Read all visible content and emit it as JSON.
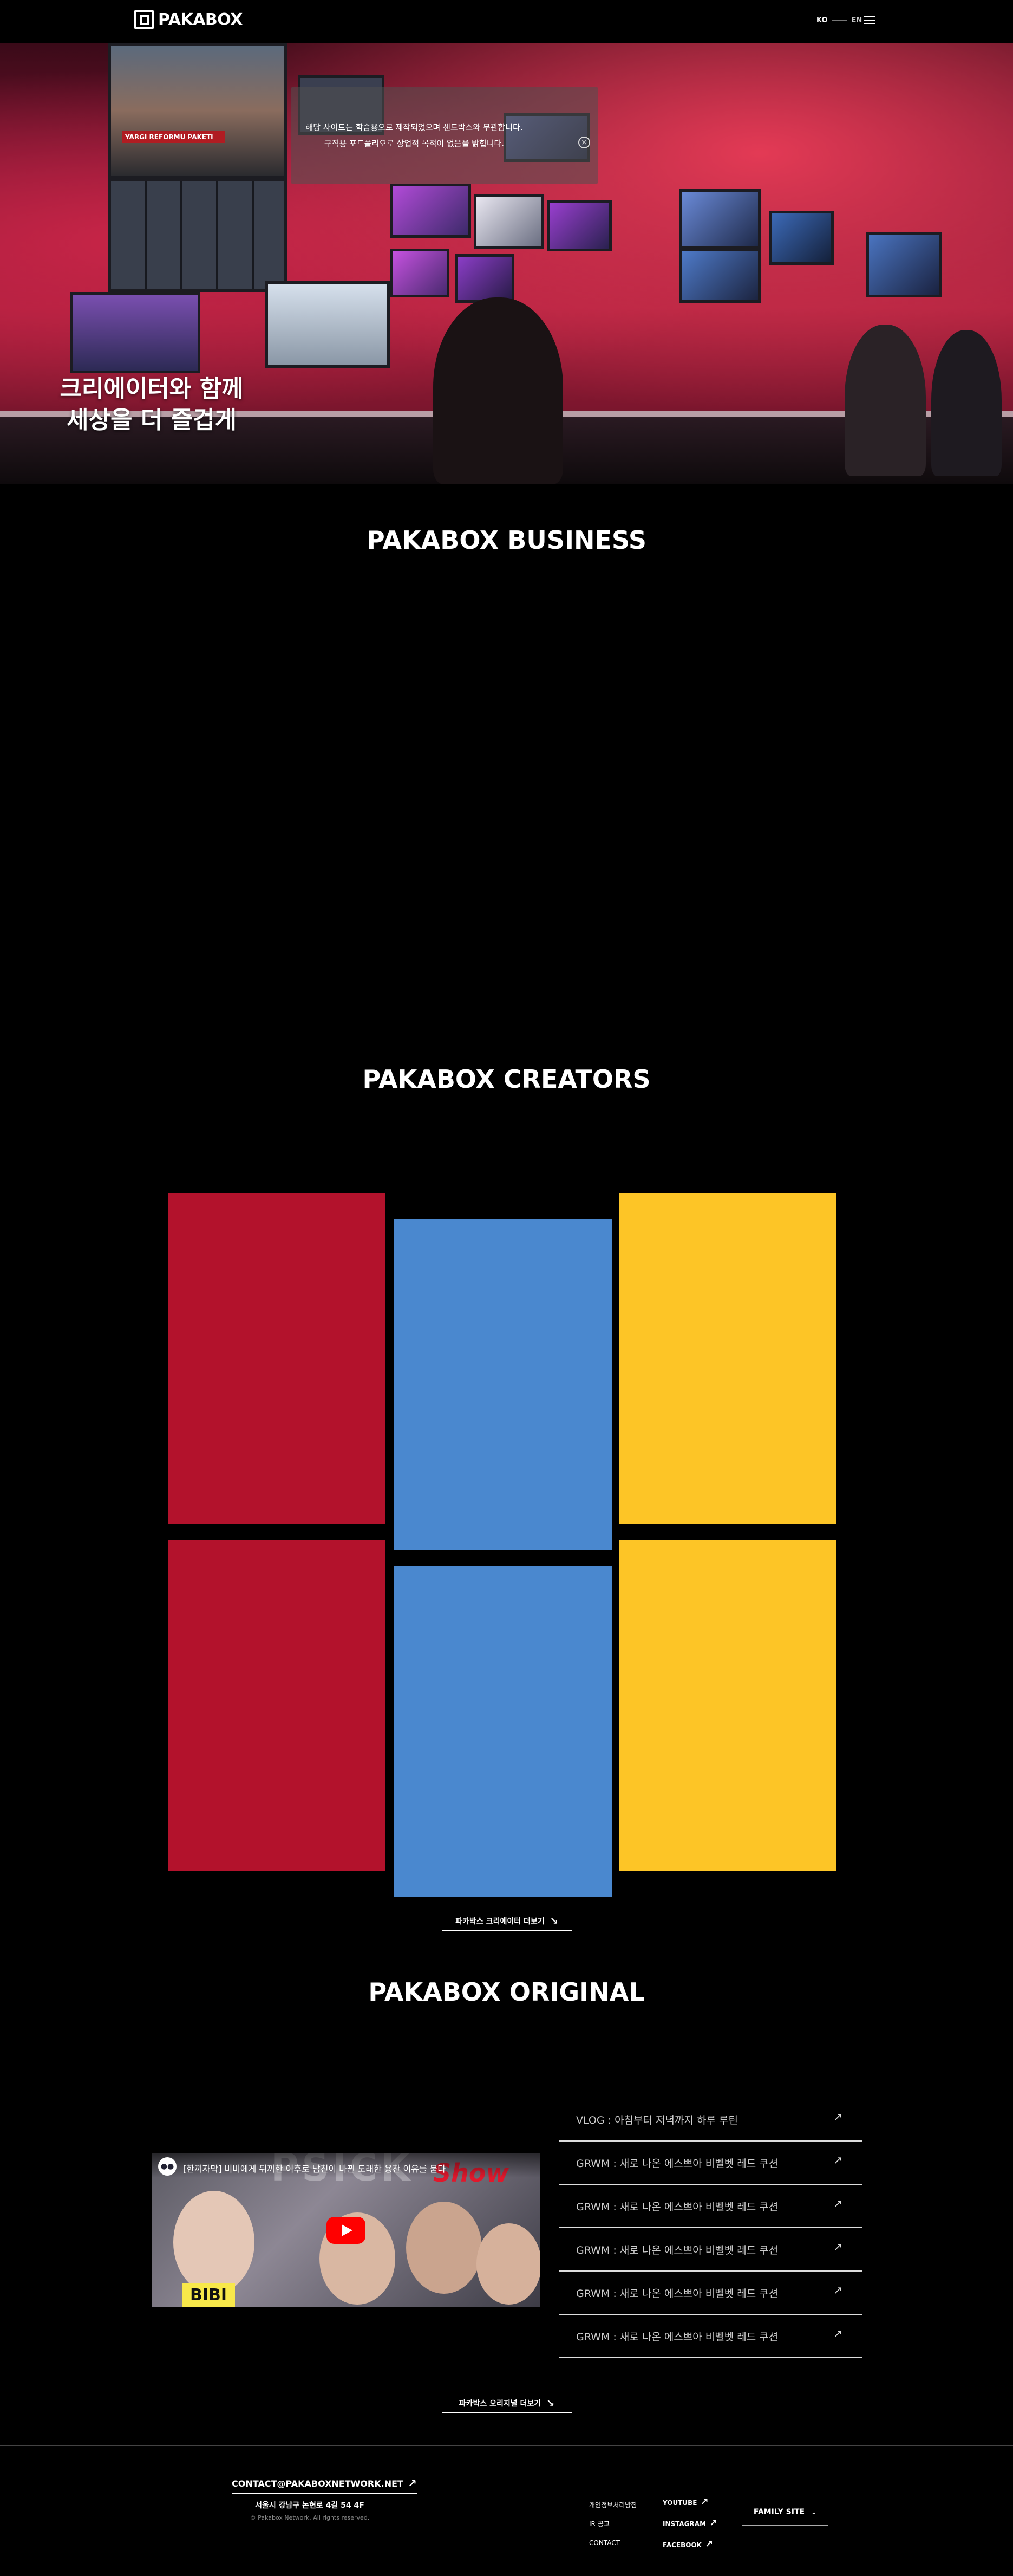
{
  "header": {
    "logo_text": "PAKABOX",
    "lang_ko": "KO",
    "lang_en": "EN"
  },
  "hero": {
    "notice_line1": "해당 사이트는 학습용으로 제작되었으며 샌드박스와 무관합니다.",
    "notice_line2": "구직용 포트폴리오로 상업적 목적이 없음을 밝힙니다.",
    "title_line1": "크리에이터와 함께",
    "title_line2": "세상을 더 즐겁게",
    "monitor_caption": "YARGI REFORMU PAKETI"
  },
  "sections": {
    "business": "PAKABOX BUSINESS",
    "creators": "PAKABOX CREATORS",
    "original": "PAKABOX ORIGINAL"
  },
  "creators": {
    "cards": [
      {
        "color": "#b3122c"
      },
      {
        "color": "#4a88cf"
      },
      {
        "color": "#fdc526"
      },
      {
        "color": "#b3122c"
      },
      {
        "color": "#4a88cf"
      },
      {
        "color": "#fdc526"
      }
    ],
    "more_label": "파카박스 크리에이터 더보기"
  },
  "original": {
    "video": {
      "title": "[한끼자막] 비비에게 뒤끼한 이후로 남친이 바뀐 도래한 용찬 이유를 묻다",
      "channel_icon": "channel-icon",
      "overlay_big": "PSICK",
      "overlay_show": "Show",
      "badge": "BIBI"
    },
    "list": [
      "VLOG : 아침부터 저녁까지 하루 루틴",
      "GRWM : 새로 나온 에스쁘아 비벨벳 레드 쿠션",
      "GRWM : 새로 나온 에스쁘아 비벨벳 레드 쿠션",
      "GRWM : 새로 나온 에스쁘아 비벨벳 레드 쿠션",
      "GRWM : 새로 나온 에스쁘아 비벨벳 레드 쿠션",
      "GRWM : 새로 나온 에스쁘아 비벨벳 레드 쿠션"
    ],
    "more_label": "파카박스 오리지널 더보기"
  },
  "footer": {
    "email": "CONTACT@PAKABOXNETWORK.NET",
    "address": "서울시 강남구 논현로 4길 54 4F",
    "copyright": "© Pakabox Network. All rights reserved.",
    "links": [
      "개인정보처리방침",
      "IR 공고",
      "CONTACT"
    ],
    "social": [
      "YOUTUBE",
      "INSTAGRAM",
      "FACEBOOK"
    ],
    "family_site": "FAMILY SITE"
  }
}
